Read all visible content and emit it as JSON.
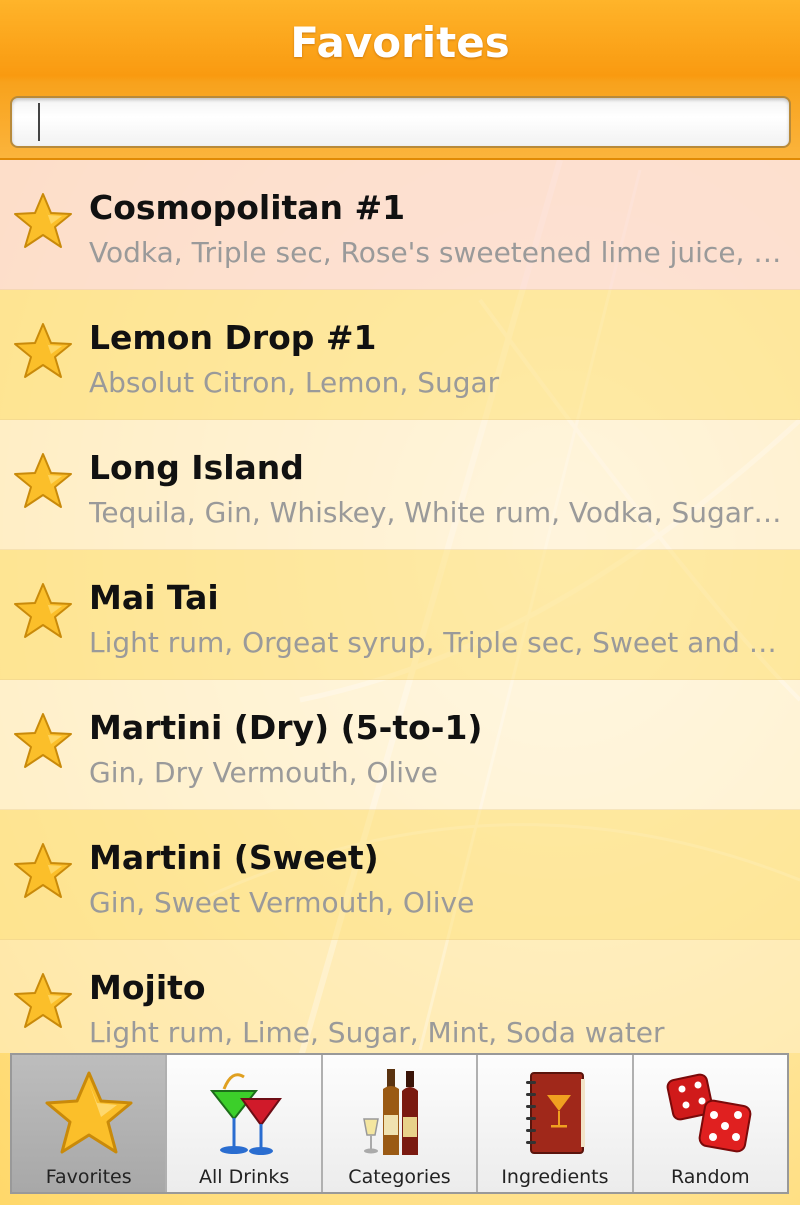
{
  "header": {
    "title": "Favorites"
  },
  "search": {
    "value": "",
    "placeholder": ""
  },
  "drinks": [
    {
      "name": "Cosmopolitan #1",
      "ingredients": "Vodka, Triple sec, Rose's sweetened lime juice, C…",
      "icon": "star-icon"
    },
    {
      "name": "Lemon Drop #1",
      "ingredients": "Absolut Citron, Lemon, Sugar",
      "icon": "star-icon"
    },
    {
      "name": "Long Island",
      "ingredients": "Tequila, Gin, Whiskey, White rum, Vodka, Sugar s…",
      "icon": "star-icon"
    },
    {
      "name": "Mai Tai",
      "ingredients": "Light rum, Orgeat syrup, Triple sec, Sweet and s…",
      "icon": "star-icon"
    },
    {
      "name": "Martini (Dry) (5-to-1)",
      "ingredients": "Gin, Dry Vermouth, Olive",
      "icon": "star-icon"
    },
    {
      "name": "Martini (Sweet)",
      "ingredients": "Gin, Sweet Vermouth, Olive",
      "icon": "star-icon"
    },
    {
      "name": "Mojito",
      "ingredients": "Light rum, Lime, Sugar, Mint, Soda water",
      "icon": "star-icon"
    }
  ],
  "tabs": [
    {
      "label": "Favorites",
      "icon": "star-icon",
      "selected": true
    },
    {
      "label": "All Drinks",
      "icon": "cocktail-glasses-icon",
      "selected": false
    },
    {
      "label": "Categories",
      "icon": "bottles-icon",
      "selected": false
    },
    {
      "label": "Ingredients",
      "icon": "recipe-book-icon",
      "selected": false
    },
    {
      "label": "Random",
      "icon": "dice-icon",
      "selected": false
    }
  ],
  "colors": {
    "header_orange": "#f99a10",
    "row_pink": "#fde3dc",
    "row_yellow": "#fde9a0",
    "row_light": "#fff4dc",
    "ingredient_gray": "#9a9a9a"
  }
}
